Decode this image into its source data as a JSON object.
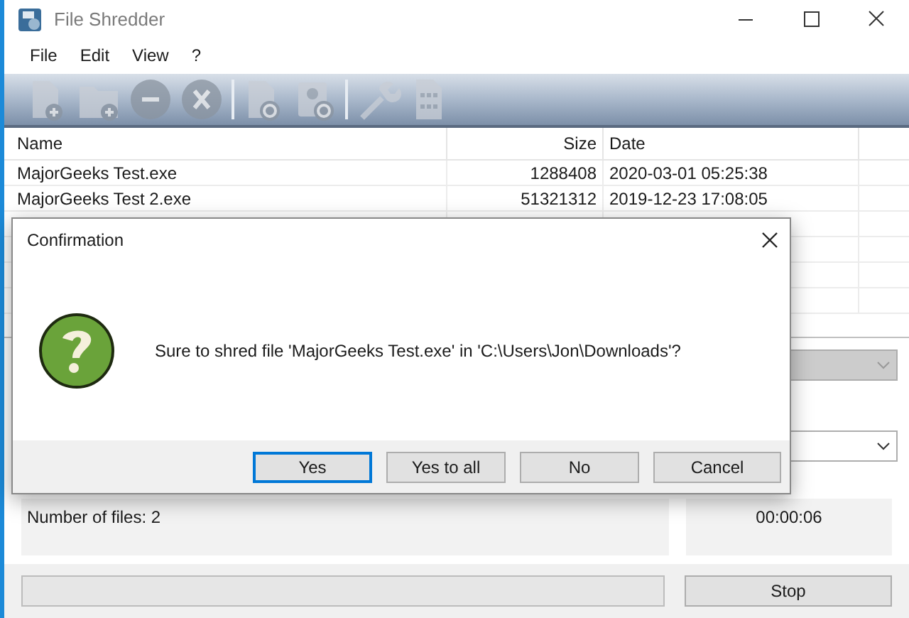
{
  "window": {
    "title": "File Shredder"
  },
  "menu": [
    "File",
    "Edit",
    "View",
    "?"
  ],
  "toolbar": [
    {
      "kind": "add-file",
      "disabled": true
    },
    {
      "kind": "add-folder",
      "disabled": true
    },
    {
      "kind": "remove",
      "disabled": true
    },
    {
      "kind": "clear",
      "disabled": true
    },
    {
      "kind": "sep"
    },
    {
      "kind": "file-cycle",
      "disabled": true
    },
    {
      "kind": "disk-cycle",
      "disabled": true
    },
    {
      "kind": "sep"
    },
    {
      "kind": "wrench",
      "disabled": true
    },
    {
      "kind": "binary",
      "disabled": true
    }
  ],
  "table": {
    "columns": [
      "Name",
      "Size",
      "Date"
    ],
    "rows": [
      [
        "MajorGeeks Test.exe",
        "1288408",
        "2020-03-01 05:25:38"
      ],
      [
        "MajorGeeks Test 2.exe",
        "51321312",
        "2019-12-23 17:08:05"
      ]
    ]
  },
  "dropdowns": [
    {
      "disabled": true
    },
    {
      "disabled": false
    }
  ],
  "status": {
    "count": "Number of files: 2",
    "time": "00:00:06"
  },
  "progress": {
    "level": 0
  },
  "stop_button": "Stop",
  "dialog": {
    "title": "Confirmation",
    "message": "Sure to shred file 'MajorGeeks Test.exe' in 'C:\\Users\\Jon\\Downloads'?",
    "buttons": [
      {
        "label": "Yes",
        "selected": true
      },
      {
        "label": "Yes to all",
        "selected": false
      },
      {
        "label": "No",
        "selected": false
      },
      {
        "label": "Cancel",
        "selected": false
      }
    ]
  }
}
